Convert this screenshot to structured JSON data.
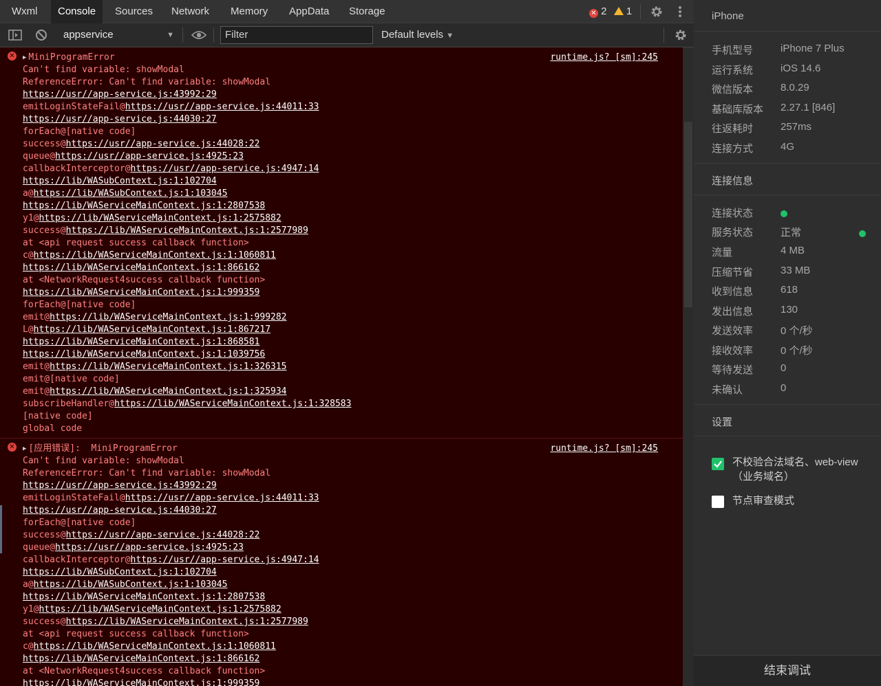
{
  "tabs": [
    {
      "label": "Wxml",
      "active": false
    },
    {
      "label": "Console",
      "active": true
    },
    {
      "label": "Sources",
      "active": false
    },
    {
      "label": "Network",
      "active": false
    },
    {
      "label": "Memory",
      "active": false
    },
    {
      "label": "AppData",
      "active": false
    },
    {
      "label": "Storage",
      "active": false
    }
  ],
  "badges": {
    "errors": "2",
    "warnings": "1"
  },
  "toolbar": {
    "context": "appservice",
    "filter_placeholder": "Filter",
    "levels": "Default levels"
  },
  "messages": [
    {
      "header": "MiniProgramError",
      "source": "runtime.js? [sm]:245",
      "lines": [
        {
          "pre": "Can't find variable: showModal",
          "link": ""
        },
        {
          "pre": "ReferenceError: Can't find variable: showModal",
          "link": ""
        },
        {
          "pre": "",
          "link": "https://usr//app-service.js:43992:29"
        },
        {
          "pre": "emitLoginStateFail@",
          "link": "https://usr//app-service.js:44011:33"
        },
        {
          "pre": "",
          "link": "https://usr//app-service.js:44030:27"
        },
        {
          "pre": "forEach@[native code]",
          "link": ""
        },
        {
          "pre": "success@",
          "link": "https://usr//app-service.js:44028:22"
        },
        {
          "pre": "queue@",
          "link": "https://usr//app-service.js:4925:23"
        },
        {
          "pre": "callbackInterceptor@",
          "link": "https://usr//app-service.js:4947:14"
        },
        {
          "pre": "",
          "link": "https://lib/WASubContext.js:1:102704"
        },
        {
          "pre": "a@",
          "link": "https://lib/WASubContext.js:1:103045"
        },
        {
          "pre": "",
          "link": "https://lib/WAServiceMainContext.js:1:2807538"
        },
        {
          "pre": "y1@",
          "link": "https://lib/WAServiceMainContext.js:1:2575882"
        },
        {
          "pre": "success@",
          "link": "https://lib/WAServiceMainContext.js:1:2577989"
        },
        {
          "pre": "at <api request success callback function>",
          "link": ""
        },
        {
          "pre": "c@",
          "link": "https://lib/WAServiceMainContext.js:1:1060811"
        },
        {
          "pre": "",
          "link": "https://lib/WAServiceMainContext.js:1:866162"
        },
        {
          "pre": "at <NetworkRequest4success callback function>",
          "link": ""
        },
        {
          "pre": "",
          "link": "https://lib/WAServiceMainContext.js:1:999359"
        },
        {
          "pre": "forEach@[native code]",
          "link": ""
        },
        {
          "pre": "emit@",
          "link": "https://lib/WAServiceMainContext.js:1:999282"
        },
        {
          "pre": "L@",
          "link": "https://lib/WAServiceMainContext.js:1:867217"
        },
        {
          "pre": "",
          "link": "https://lib/WAServiceMainContext.js:1:868581"
        },
        {
          "pre": "",
          "link": "https://lib/WAServiceMainContext.js:1:1039756"
        },
        {
          "pre": "emit@",
          "link": "https://lib/WAServiceMainContext.js:1:326315"
        },
        {
          "pre": "emit@[native code]",
          "link": ""
        },
        {
          "pre": "emit@",
          "link": "https://lib/WAServiceMainContext.js:1:325934"
        },
        {
          "pre": "subscribeHandler@",
          "link": "https://lib/WAServiceMainContext.js:1:328583"
        },
        {
          "pre": "[native code]",
          "link": ""
        },
        {
          "pre": "global code",
          "link": ""
        }
      ]
    },
    {
      "header": "[应用错误]:  MiniProgramError",
      "source": "runtime.js? [sm]:245",
      "lines": [
        {
          "pre": "Can't find variable: showModal",
          "link": ""
        },
        {
          "pre": "ReferenceError: Can't find variable: showModal",
          "link": ""
        },
        {
          "pre": "",
          "link": "https://usr//app-service.js:43992:29"
        },
        {
          "pre": "emitLoginStateFail@",
          "link": "https://usr//app-service.js:44011:33"
        },
        {
          "pre": "",
          "link": "https://usr//app-service.js:44030:27"
        },
        {
          "pre": "forEach@[native code]",
          "link": ""
        },
        {
          "pre": "success@",
          "link": "https://usr//app-service.js:44028:22"
        },
        {
          "pre": "queue@",
          "link": "https://usr//app-service.js:4925:23"
        },
        {
          "pre": "callbackInterceptor@",
          "link": "https://usr//app-service.js:4947:14"
        },
        {
          "pre": "",
          "link": "https://lib/WASubContext.js:1:102704"
        },
        {
          "pre": "a@",
          "link": "https://lib/WASubContext.js:1:103045"
        },
        {
          "pre": "",
          "link": "https://lib/WAServiceMainContext.js:1:2807538"
        },
        {
          "pre": "y1@",
          "link": "https://lib/WAServiceMainContext.js:1:2575882"
        },
        {
          "pre": "success@",
          "link": "https://lib/WAServiceMainContext.js:1:2577989"
        },
        {
          "pre": "at <api request success callback function>",
          "link": ""
        },
        {
          "pre": "c@",
          "link": "https://lib/WAServiceMainContext.js:1:1060811"
        },
        {
          "pre": "",
          "link": "https://lib/WAServiceMainContext.js:1:866162"
        },
        {
          "pre": "at <NetworkRequest4success callback function>",
          "link": ""
        },
        {
          "pre": "",
          "link": "https://lib/WAServiceMainContext.js:1:999359"
        }
      ]
    }
  ],
  "panel": {
    "device_title": "iPhone",
    "device_info": [
      {
        "k": "手机型号",
        "v": "iPhone 7 Plus"
      },
      {
        "k": "运行系统",
        "v": "iOS 14.6"
      },
      {
        "k": "微信版本",
        "v": "8.0.29"
      },
      {
        "k": "基础库版本",
        "v": "2.27.1 [846]"
      },
      {
        "k": "往返耗时",
        "v": "257ms"
      },
      {
        "k": "连接方式",
        "v": "4G"
      }
    ],
    "conn_title": "连接信息",
    "conn_status_label": "连接状态",
    "service_status_label": "服务状态",
    "service_status_value": "正常",
    "conn_info": [
      {
        "k": "流量",
        "v": "4 MB"
      },
      {
        "k": "压缩节省",
        "v": "33 MB"
      },
      {
        "k": "收到信息",
        "v": "618"
      },
      {
        "k": "发出信息",
        "v": "130"
      },
      {
        "k": "发送效率",
        "v": "0 个/秒"
      },
      {
        "k": "接收效率",
        "v": "0 个/秒"
      },
      {
        "k": "等待发送",
        "v": "0"
      },
      {
        "k": "未确认",
        "v": "0"
      }
    ],
    "settings_title": "设置",
    "opt_domain": "不校验合法域名、web-view（业务域名）",
    "opt_node": "节点审查模式",
    "stop_button": "结束调试"
  }
}
